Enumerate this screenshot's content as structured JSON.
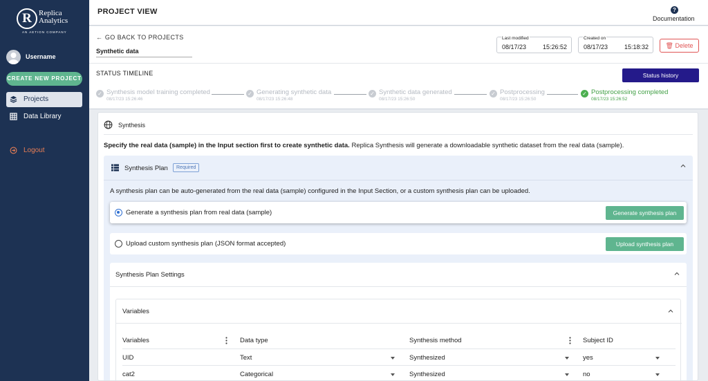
{
  "brand": {
    "logo_letter": "R",
    "name_line1": "Replica",
    "name_line2": "Analytics",
    "tagline": "AN AETION COMPANY"
  },
  "sidebar": {
    "username": "Username",
    "new_project": "CREATE NEW PROJECT",
    "items": [
      {
        "label": "Projects",
        "icon": "layers-icon",
        "active": true
      },
      {
        "label": "Data Library",
        "icon": "table-icon",
        "active": false
      }
    ],
    "logout": "Logout"
  },
  "header": {
    "title": "PROJECT VIEW",
    "documentation": "Documentation"
  },
  "project": {
    "back_label": "GO BACK TO PROJECTS",
    "name": "Synthetic data",
    "last_modified_label": "Last modified",
    "last_modified_date": "08/17/23",
    "last_modified_time": "15:26:52",
    "created_label": "Created on",
    "created_date": "08/17/23",
    "created_time": "15:18:32",
    "delete_label": "Delete"
  },
  "timeline": {
    "title": "STATUS TIMELINE",
    "history_button": "Status history",
    "steps": [
      {
        "name": "Synthesis model training completed",
        "time": "08/17/23 15:26:46",
        "done": false
      },
      {
        "name": "Generating synthetic data",
        "time": "08/17/23 15:26:48",
        "done": false
      },
      {
        "name": "Synthetic data generated",
        "time": "08/17/23 15:26:50",
        "done": false
      },
      {
        "name": "Postprocessing",
        "time": "08/17/23 15:26:50",
        "done": false
      },
      {
        "name": "Postprocessing completed",
        "time": "08/17/23 15:26:52",
        "done": true
      }
    ]
  },
  "synthesis": {
    "title": "Synthesis",
    "desc_bold": "Specify the real data (sample) in the Input section first to create synthetic data.",
    "desc_rest": " Replica Synthesis will generate a downloadable synthetic dataset from the real data (sample).",
    "plan": {
      "title": "Synthesis Plan",
      "badge": "Required",
      "desc": "A synthesis plan can be auto-generated from the real data (sample) configured in the Input Section, or a custom synthesis plan can be uploaded.",
      "option1_label": "Generate a synthesis plan from real data (sample)",
      "option1_button": "Generate synthesis plan",
      "option2_label": "Upload custom synthesis plan (JSON format accepted)",
      "option2_button": "Upload synthesis plan"
    },
    "settings_title": "Synthesis Plan Settings",
    "variables": {
      "title": "Variables",
      "columns": [
        "Variables",
        "Data type",
        "Synthesis method",
        "Subject ID"
      ],
      "rows": [
        [
          "UID",
          "Text",
          "Synthesized",
          "yes"
        ],
        [
          "cat2",
          "Categorical",
          "Synthesized",
          "no"
        ]
      ]
    }
  }
}
